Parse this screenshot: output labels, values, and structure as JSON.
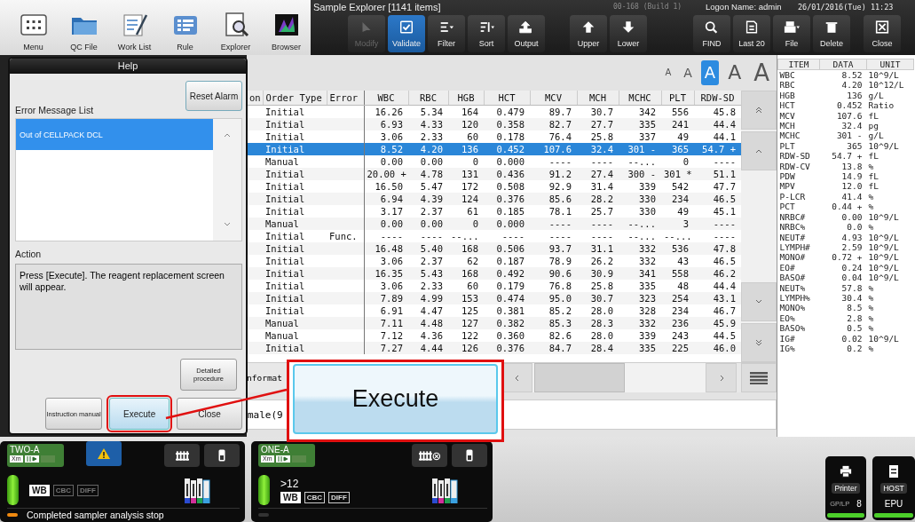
{
  "app_toolbar": [
    {
      "label": "Menu"
    },
    {
      "label": "QC File"
    },
    {
      "label": "Work List"
    },
    {
      "label": "Rule"
    },
    {
      "label": "Explorer"
    },
    {
      "label": "Browser"
    }
  ],
  "explorer": {
    "title": "Sample Explorer [1141 items]",
    "build": "00-168 (Build 1)",
    "logon": "Logon Name: admin",
    "datetime": "26/01/2016(Tue) 11:23",
    "button_groups": [
      {
        "buttons": [
          {
            "label": "Modify",
            "disabled": true,
            "active": false
          },
          {
            "label": "Validate",
            "disabled": false,
            "active": true
          },
          {
            "label": "Filter",
            "disabled": false,
            "active": false
          },
          {
            "label": "Sort",
            "disabled": false,
            "active": false
          },
          {
            "label": "Output",
            "disabled": false,
            "active": false
          }
        ]
      },
      {
        "buttons": [
          {
            "label": "Upper",
            "disabled": false,
            "active": false
          },
          {
            "label": "Lower",
            "disabled": false,
            "active": false
          }
        ]
      },
      {
        "buttons": [
          {
            "label": "FIND",
            "disabled": false,
            "active": false
          },
          {
            "label": "Last 20",
            "disabled": false,
            "active": false
          },
          {
            "label": "File",
            "disabled": false,
            "active": false
          },
          {
            "label": "Delete",
            "disabled": false,
            "active": false
          }
        ]
      },
      {
        "buttons": [
          {
            "label": "Close",
            "disabled": false,
            "active": false
          }
        ]
      }
    ]
  },
  "font_sizes": [
    {
      "label": "A",
      "selected": false
    },
    {
      "label": "A",
      "selected": false
    },
    {
      "label": "A",
      "selected": true
    },
    {
      "label": "A",
      "selected": false
    },
    {
      "label": "A",
      "selected": false
    }
  ],
  "table": {
    "columns": [
      "on",
      "Order Type",
      "Error",
      "WBC",
      "RBC",
      "HGB",
      "HCT",
      "MCV",
      "MCH",
      "MCHC",
      "PLT",
      "RDW-SD"
    ],
    "rows": [
      {
        "selected": false,
        "order_type": "Initial",
        "values": [
          "16.26",
          "5.34",
          "164",
          "0.479",
          "89.7",
          "30.7",
          "342",
          "556",
          "45.8"
        ]
      },
      {
        "selected": false,
        "order_type": "Initial",
        "values": [
          "6.93",
          "4.33",
          "120",
          "0.358",
          "82.7",
          "27.7",
          "335",
          "241",
          "44.4"
        ]
      },
      {
        "selected": false,
        "order_type": "Initial",
        "values": [
          "3.06",
          "2.33",
          "60",
          "0.178",
          "76.4",
          "25.8",
          "337",
          "49",
          "44.1"
        ]
      },
      {
        "selected": true,
        "order_type": "Initial",
        "values": [
          "8.52",
          "4.20",
          "136",
          "0.452",
          "107.6",
          "32.4",
          "301 -",
          "365",
          "54.7 +"
        ]
      },
      {
        "selected": false,
        "order_type": "Manual",
        "values": [
          "0.00",
          "0.00",
          "0",
          "0.000",
          "----",
          "----",
          "--...",
          "0",
          "----"
        ]
      },
      {
        "selected": false,
        "order_type": "Initial",
        "values": [
          "20.00 +",
          "4.78",
          "131",
          "0.436",
          "91.2",
          "27.4",
          "300 -",
          "301 *",
          "51.1"
        ]
      },
      {
        "selected": false,
        "order_type": "Initial",
        "values": [
          "16.50",
          "5.47",
          "172",
          "0.508",
          "92.9",
          "31.4",
          "339",
          "542",
          "47.7"
        ]
      },
      {
        "selected": false,
        "order_type": "Initial",
        "values": [
          "6.94",
          "4.39",
          "124",
          "0.376",
          "85.6",
          "28.2",
          "330",
          "234",
          "46.5"
        ]
      },
      {
        "selected": false,
        "order_type": "Initial",
        "values": [
          "3.17",
          "2.37",
          "61",
          "0.185",
          "78.1",
          "25.7",
          "330",
          "49",
          "45.1"
        ]
      },
      {
        "selected": false,
        "order_type": "Manual",
        "values": [
          "0.00",
          "0.00",
          "0",
          "0.000",
          "----",
          "----",
          "--...",
          "3",
          "----"
        ]
      },
      {
        "selected": false,
        "order_type": "Initial",
        "error": "Func.",
        "values": [
          "----",
          "----",
          "--...",
          "----",
          "----",
          "----",
          "--...",
          "--...",
          "----"
        ]
      },
      {
        "selected": false,
        "order_type": "Initial",
        "values": [
          "16.48",
          "5.40",
          "168",
          "0.506",
          "93.7",
          "31.1",
          "332",
          "536",
          "47.8"
        ]
      },
      {
        "selected": false,
        "order_type": "Initial",
        "values": [
          "3.06",
          "2.37",
          "62",
          "0.187",
          "78.9",
          "26.2",
          "332",
          "43",
          "46.5"
        ]
      },
      {
        "selected": false,
        "order_type": "Initial",
        "values": [
          "16.35",
          "5.43",
          "168",
          "0.492",
          "90.6",
          "30.9",
          "341",
          "558",
          "46.2"
        ]
      },
      {
        "selected": false,
        "order_type": "Initial",
        "values": [
          "3.06",
          "2.33",
          "60",
          "0.179",
          "76.8",
          "25.8",
          "335",
          "48",
          "44.4"
        ]
      },
      {
        "selected": false,
        "order_type": "Initial",
        "values": [
          "7.89",
          "4.99",
          "153",
          "0.474",
          "95.0",
          "30.7",
          "323",
          "254",
          "43.1"
        ]
      },
      {
        "selected": false,
        "order_type": "Initial",
        "values": [
          "6.91",
          "4.47",
          "125",
          "0.381",
          "85.2",
          "28.0",
          "328",
          "234",
          "46.7"
        ]
      },
      {
        "selected": false,
        "order_type": "Manual",
        "values": [
          "7.11",
          "4.48",
          "127",
          "0.382",
          "85.3",
          "28.3",
          "332",
          "236",
          "45.9"
        ]
      },
      {
        "selected": false,
        "order_type": "Manual",
        "values": [
          "7.12",
          "4.36",
          "122",
          "0.360",
          "82.6",
          "28.0",
          "339",
          "243",
          "44.5"
        ]
      },
      {
        "selected": false,
        "order_type": "Initial",
        "values": [
          "7.27",
          "4.44",
          "126",
          "0.376",
          "84.7",
          "28.4",
          "335",
          "225",
          "46.0"
        ]
      }
    ]
  },
  "info_tab": "nformat",
  "info_field": "male(9",
  "result_panel": {
    "columns": [
      "ITEM",
      "DATA",
      "UNIT"
    ],
    "rows": [
      [
        "WBC",
        "8.52",
        "10^9/L"
      ],
      [
        "RBC",
        "4.20",
        "10^12/L"
      ],
      [
        "HGB",
        "136",
        "g/L"
      ],
      [
        "HCT",
        "0.452",
        "Ratio"
      ],
      [
        "MCV",
        "107.6",
        "fL"
      ],
      [
        "MCH",
        "32.4",
        "pg"
      ],
      [
        "MCHC",
        "301 -",
        "g/L"
      ],
      [
        "PLT",
        "365",
        "10^9/L"
      ],
      [
        "RDW-SD",
        "54.7 +",
        "fL"
      ],
      [
        "RDW-CV",
        "13.8",
        "%"
      ],
      [
        "PDW",
        "14.9",
        "fL"
      ],
      [
        "MPV",
        "12.0",
        "fL"
      ],
      [
        "P-LCR",
        "41.4",
        "%"
      ],
      [
        "PCT",
        "0.44 +",
        "%"
      ],
      [
        "NRBC#",
        "0.00",
        "10^9/L"
      ],
      [
        "NRBC%",
        "0.0",
        "%"
      ],
      [
        "NEUT#",
        "4.93",
        "10^9/L"
      ],
      [
        "LYMPH#",
        "2.59",
        "10^9/L"
      ],
      [
        "MONO#",
        "0.72 +",
        "10^9/L"
      ],
      [
        "EO#",
        "0.24",
        "10^9/L"
      ],
      [
        "BASO#",
        "0.04",
        "10^9/L"
      ],
      [
        "NEUT%",
        "57.8",
        "%"
      ],
      [
        "LYMPH%",
        "30.4",
        "%"
      ],
      [
        "MONO%",
        "8.5",
        "%"
      ],
      [
        "EO%",
        "2.8",
        "%"
      ],
      [
        "BASO%",
        "0.5",
        "%"
      ],
      [
        "IG#",
        "0.02",
        "10^9/L"
      ],
      [
        "IG%",
        "0.2",
        "%"
      ]
    ]
  },
  "help_dialog": {
    "title": "Help",
    "reset_button": "Reset Alarm",
    "list_label": "Error Message List",
    "messages": [
      {
        "text": "Out of CELLPACK DCL",
        "selected": true
      }
    ],
    "action_label": "Action",
    "action_text": "Press [Execute]. The reagent replacement screen will appear.",
    "detail_button": "Detailed procedure",
    "buttons": [
      {
        "label": "Instruction manual",
        "highlighted": false
      },
      {
        "label": "Execute",
        "highlighted": true
      },
      {
        "label": "Close",
        "highlighted": false
      }
    ]
  },
  "callout": {
    "label": "Execute"
  },
  "modules": [
    {
      "name": "TWO-A",
      "chip": "Xm",
      "warning": true,
      "rack_error": false,
      "message": "Completed sampler analysis stop",
      "modes": [
        {
          "label": "WB",
          "selected": true,
          "disabled": false
        },
        {
          "label": "CBC",
          "selected": false,
          "disabled": true
        },
        {
          "label": "DIFF",
          "selected": false,
          "disabled": true
        }
      ]
    },
    {
      "name": "ONE-A",
      "chip": "Xm",
      "warning": false,
      "rack_error": true,
      "count": ">12",
      "modes": [
        {
          "label": "WB",
          "selected": true,
          "disabled": false
        },
        {
          "label": "CBC",
          "selected": false,
          "disabled": false
        },
        {
          "label": "DIFF",
          "selected": false,
          "disabled": false
        }
      ]
    }
  ],
  "devices": [
    {
      "label": "Printer",
      "sub_label": "GP/LP",
      "value": "8"
    },
    {
      "label": "HOST",
      "value": "EPU"
    }
  ]
}
